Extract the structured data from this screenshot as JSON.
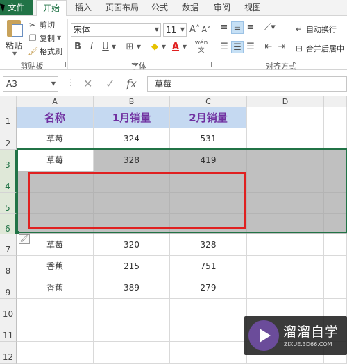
{
  "ribbon": {
    "tabs": [
      "文件",
      "开始",
      "插入",
      "页面布局",
      "公式",
      "数据",
      "审阅",
      "视图"
    ],
    "active_tab": "开始",
    "clipboard": {
      "paste": "粘贴",
      "cut": "剪切",
      "copy": "复制",
      "format_painter": "格式刷",
      "group": "剪贴板"
    },
    "font": {
      "name": "宋体",
      "size": "11",
      "bold": "B",
      "italic": "I",
      "underline": "U",
      "group": "字体",
      "phonetic": "wén"
    },
    "alignment": {
      "wrap": "自动换行",
      "merge": "合并后居中",
      "group": "对齐方式"
    }
  },
  "formula_bar": {
    "name_box": "A3",
    "fx": "fx",
    "value": "草莓"
  },
  "sheet": {
    "columns": [
      "A",
      "B",
      "C",
      "D"
    ],
    "row_numbers": [
      "1",
      "2",
      "3",
      "4",
      "5",
      "6",
      "7",
      "8",
      "9",
      "10",
      "11",
      "12"
    ],
    "header": [
      "名称",
      "1月销量",
      "2月销量"
    ],
    "rows": [
      [
        "草莓",
        "324",
        "531"
      ],
      [
        "草莓",
        "328",
        "419"
      ],
      [
        "",
        "",
        ""
      ],
      [
        "",
        "",
        ""
      ],
      [
        "",
        "",
        ""
      ],
      [
        "草莓",
        "320",
        "328"
      ],
      [
        "香蕉",
        "215",
        "751"
      ],
      [
        "香蕉",
        "389",
        "279"
      ]
    ]
  },
  "colors": {
    "excel_green": "#217346",
    "header_fill": "#c5d9f1",
    "header_text": "#7030a0",
    "selection_gray": "#c0c0c0",
    "annotation_red": "#e02020"
  },
  "watermark": {
    "title": "溜溜自学",
    "url": "ZIXUE.3D66.COM"
  }
}
